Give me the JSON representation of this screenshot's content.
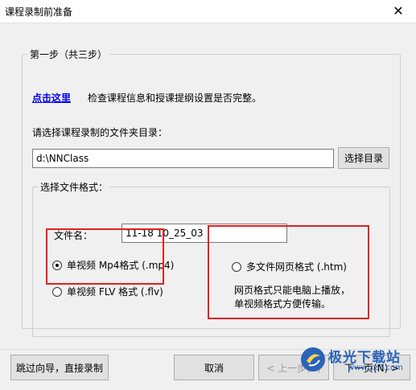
{
  "window": {
    "title": "课程录制前准备",
    "close_glyph": "✕"
  },
  "step_group": {
    "legend": "第一步（共三步）",
    "link_text": "点击这里",
    "hint_text": "检查课程信息和授课提纲设置是否完整。",
    "dir_label": "请选择课程录制的文件夹目录：",
    "dir_value": "d:\\NNClass",
    "dir_button": "选择目录"
  },
  "format_group": {
    "legend": "选择文件格式：",
    "filename_label": "文件名：",
    "filename_value": "11-18 10_25_03",
    "options": [
      {
        "label": "单视频 Mp4格式 (.mp4)",
        "checked": true
      },
      {
        "label": "单视频 FLV 格式 (.flv)",
        "checked": false
      },
      {
        "label": "多文件网页格式 (.htm)",
        "checked": false
      }
    ],
    "htm_desc_line1": "网页格式只能电脑上播放，",
    "htm_desc_line2": "单视频格式方便传输。"
  },
  "buttons": {
    "skip": "跳过向导，直接录制",
    "cancel": "取消",
    "prev": "< 上一步(B)",
    "next": "下一页(N) >"
  },
  "watermark": {
    "brand": "极光下载站",
    "url": "www.xz7.com"
  },
  "colors": {
    "highlight_box": "#e02020",
    "link": "#0000ee",
    "watermark": "#2a63b8"
  }
}
